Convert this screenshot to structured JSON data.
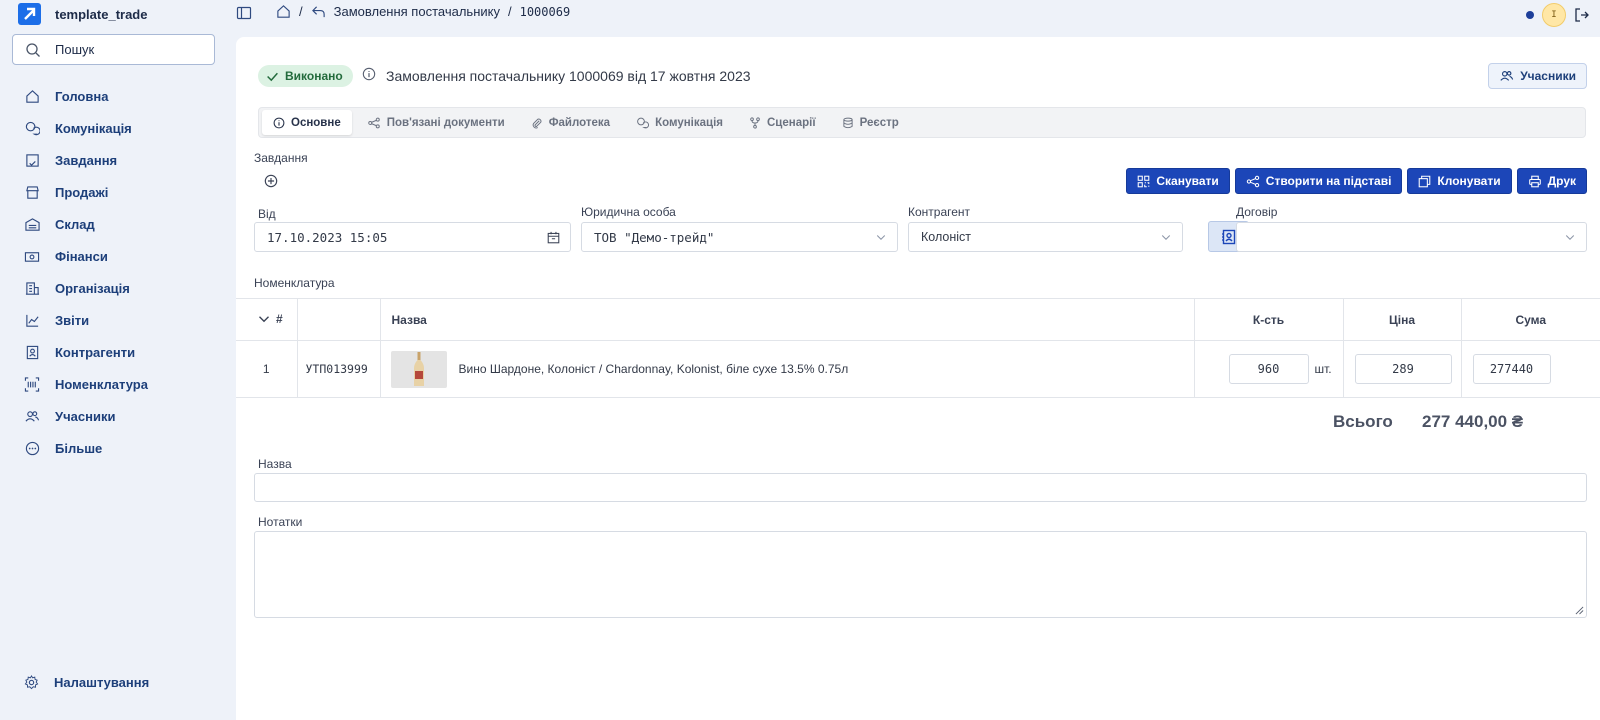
{
  "app": {
    "name": "template_trade"
  },
  "search": {
    "label": "Пошук"
  },
  "sidebar": {
    "items": [
      {
        "label": "Головна",
        "icon": "home-icon"
      },
      {
        "label": "Комунікація",
        "icon": "chat-icon"
      },
      {
        "label": "Завдання",
        "icon": "tasks-icon"
      },
      {
        "label": "Продажі",
        "icon": "store-icon"
      },
      {
        "label": "Склад",
        "icon": "warehouse-icon"
      },
      {
        "label": "Фінанси",
        "icon": "money-icon"
      },
      {
        "label": "Організація",
        "icon": "building-icon"
      },
      {
        "label": "Звіти",
        "icon": "chart-icon"
      },
      {
        "label": "Контрагенти",
        "icon": "contacts-icon"
      },
      {
        "label": "Номенклатура",
        "icon": "barcode-icon"
      },
      {
        "label": "Учасники",
        "icon": "users-icon"
      },
      {
        "label": "Більше",
        "icon": "more-icon"
      }
    ],
    "settings_label": "Налаштування"
  },
  "breadcrumb": {
    "section": "Замовлення постачальнику",
    "separator": "/",
    "number": "1000069"
  },
  "header": {
    "status": "Виконано",
    "title": "Замовлення постачальнику 1000069 від 17 жовтня 2023",
    "participants_label": "Учасники"
  },
  "tabs": [
    {
      "label": "Основне"
    },
    {
      "label": "Пов'язані документи"
    },
    {
      "label": "Файлотека"
    },
    {
      "label": "Комунікація"
    },
    {
      "label": "Сценарії"
    },
    {
      "label": "Реєстр"
    }
  ],
  "tasks_label": "Завдання",
  "actions": {
    "scan": "Сканувати",
    "create_based": "Створити на підставі",
    "clone": "Клонувати",
    "print": "Друк"
  },
  "form": {
    "date_label": "Від",
    "date_value": "17.10.2023 15:05",
    "legal_label": "Юридична особа",
    "legal_value": "ТОВ \"Демо-трейд\"",
    "counterparty_label": "Контрагент",
    "counterparty_value": "Колоніст",
    "contract_label": "Договір",
    "contract_value": ""
  },
  "nomenclature": {
    "label": "Номенклатура",
    "columns": {
      "num": "#",
      "name": "Назва",
      "qty": "К-сть",
      "price": "Ціна",
      "sum": "Сума"
    },
    "rows": [
      {
        "num": "1",
        "sku": "УТП013999",
        "name": "Вино Шардоне, Колоніст / Chardonnay, Kolonist, біле сухе 13.5% 0.75л",
        "qty": "960",
        "unit": "шт.",
        "price": "289",
        "sum": "277440"
      }
    ]
  },
  "totals": {
    "label": "Всього",
    "value": "277 440,00 ₴"
  },
  "name_field": {
    "label": "Назва",
    "value": ""
  },
  "notes_field": {
    "label": "Нотатки",
    "value": ""
  },
  "colors": {
    "accent": "#1c46b8",
    "status": "#236b3c",
    "sidebar_bg": "#eef2f9"
  }
}
